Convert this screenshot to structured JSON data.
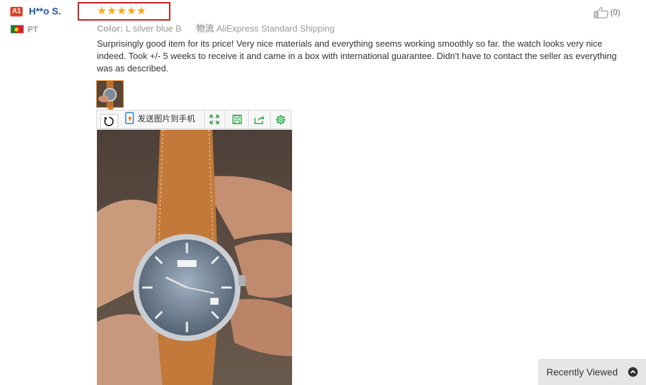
{
  "reviewer": {
    "badge": "A1",
    "name": "H**o S.",
    "country_code": "PT"
  },
  "rating": {
    "stars": 5,
    "glyphs": "★★★★★"
  },
  "meta": {
    "color_label": "Color:",
    "color_value": "L silver blue B",
    "shipping_label": "物流",
    "shipping_value": "AliExpress Standard Shipping"
  },
  "helpful": {
    "count": "(0)"
  },
  "review": {
    "text": "Surprisingly good item for its price! Very nice materials and everything seems working smoothly so far. the watch looks very nice indeed. Took +/- 5 weeks to receive it and came in a box with international guarantee. Didn't have to contact the seller as everything was as described."
  },
  "toolbar": {
    "send_label": "发送图片到手机"
  },
  "recently_viewed": {
    "label": "Recently Viewed"
  },
  "colors": {
    "accent": "#e8801a",
    "link": "#1c58a7",
    "highlight_box": "#cc1a1a",
    "star": "#f5a623"
  }
}
